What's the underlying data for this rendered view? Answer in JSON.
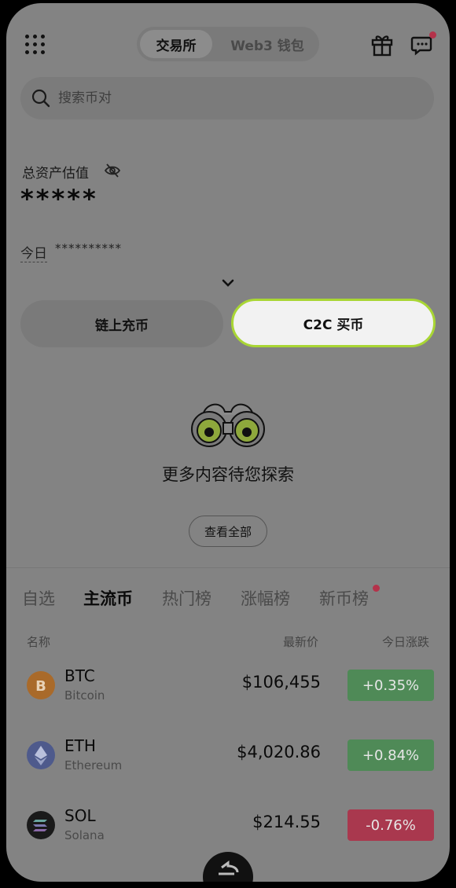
{
  "header": {
    "tabs": [
      {
        "label": "交易所"
      },
      {
        "label": "Web3 钱包"
      }
    ]
  },
  "search": {
    "placeholder": "搜索币对"
  },
  "assets": {
    "label": "总资产估值",
    "value": "*****",
    "today_label": "今日",
    "today_value": "**********"
  },
  "actions": {
    "deposit_label": "链上充币",
    "c2c_label": "C2C 买币"
  },
  "empty_state": {
    "message": "更多内容待您探索",
    "view_all": "查看全部"
  },
  "market_tabs": [
    {
      "label": "自选"
    },
    {
      "label": "主流币"
    },
    {
      "label": "热门榜"
    },
    {
      "label": "涨幅榜"
    },
    {
      "label": "新币榜"
    }
  ],
  "table": {
    "headers": {
      "name": "名称",
      "price": "最新价",
      "change": "今日涨跌"
    },
    "rows": [
      {
        "symbol": "BTC",
        "name": "Bitcoin",
        "price": "$106,455",
        "change": "+0.35%",
        "icon": "bitcoin-icon",
        "icon_color": "#a96a2a",
        "change_color": "#4f8a57"
      },
      {
        "symbol": "ETH",
        "name": "Ethereum",
        "price": "$4,020.86",
        "change": "+0.84%",
        "icon": "ethereum-icon",
        "icon_color": "#4e5a8c",
        "change_color": "#4f8a57"
      },
      {
        "symbol": "SOL",
        "name": "Solana",
        "price": "$214.55",
        "change": "-0.76%",
        "icon": "solana-icon",
        "icon_color": "#1a1a1a",
        "change_color": "#a9384e"
      }
    ]
  },
  "colors": {
    "accent": "#a9d634",
    "up": "#4f8a57",
    "down": "#a9384e",
    "notification": "#b4324a"
  }
}
